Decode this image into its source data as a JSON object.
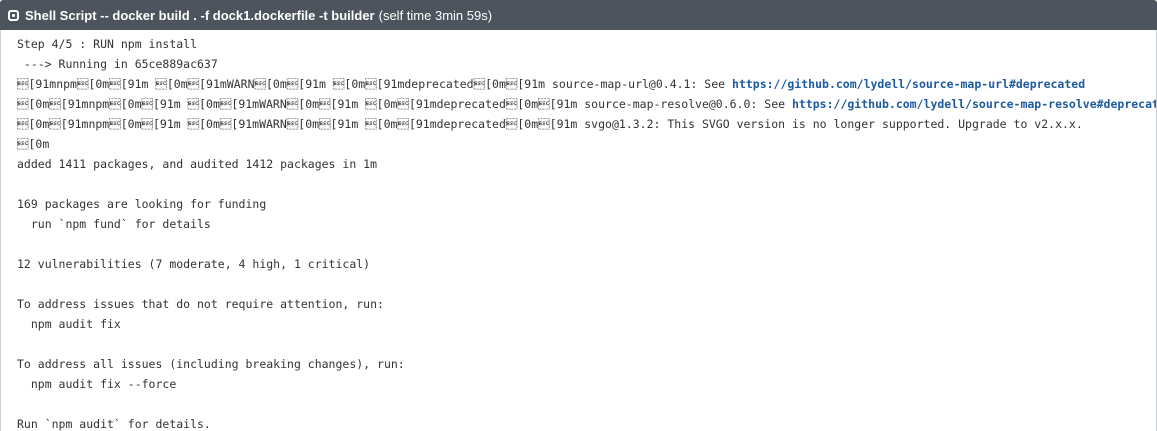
{
  "step": {
    "title": "Shell Script -- docker build . -f dock1.dockerfile -t builder",
    "meta": "(self time 3min 59s)"
  },
  "log": {
    "lines": [
      {
        "text": "Step 4/5 : RUN npm install"
      },
      {
        "text": " ---> Running in 65ce889ac637"
      },
      {
        "text": "\u001b[91mnpm\u001b[0m\u001b[91m \u001b[0m\u001b[91mWARN\u001b[0m\u001b[91m \u001b[0m\u001b[91mdeprecated\u001b[0m\u001b[91m source-map-url@0.4.1: See ",
        "link": "https://github.com/lydell/source-map-url#deprecated"
      },
      {
        "text": "\u001b[0m\u001b[91mnpm\u001b[0m\u001b[91m \u001b[0m\u001b[91mWARN\u001b[0m\u001b[91m \u001b[0m\u001b[91mdeprecated\u001b[0m\u001b[91m source-map-resolve@0.6.0: See ",
        "link": "https://github.com/lydell/source-map-resolve#deprecated"
      },
      {
        "text": "\u001b[0m\u001b[91mnpm\u001b[0m\u001b[91m \u001b[0m\u001b[91mWARN\u001b[0m\u001b[91m \u001b[0m\u001b[91mdeprecated\u001b[0m\u001b[91m svgo@1.3.2: This SVGO version is no longer supported. Upgrade to v2.x.x."
      },
      {
        "text": "\u001b[0m"
      },
      {
        "text": "added 1411 packages, and audited 1412 packages in 1m"
      },
      {
        "text": ""
      },
      {
        "text": "169 packages are looking for funding"
      },
      {
        "text": "  run `npm fund` for details"
      },
      {
        "text": ""
      },
      {
        "text": "12 vulnerabilities (7 moderate, 4 high, 1 critical)"
      },
      {
        "text": ""
      },
      {
        "text": "To address issues that do not require attention, run:"
      },
      {
        "text": "  npm audit fix"
      },
      {
        "text": ""
      },
      {
        "text": "To address all issues (including breaking changes), run:"
      },
      {
        "text": "  npm audit fix --force"
      },
      {
        "text": ""
      },
      {
        "text": "Run `npm audit` for details."
      }
    ]
  },
  "colors": {
    "header_bg": "#4d545d",
    "link": "#1d5aa0",
    "text": "#333333"
  },
  "icons": {
    "step": "step-status-icon"
  }
}
